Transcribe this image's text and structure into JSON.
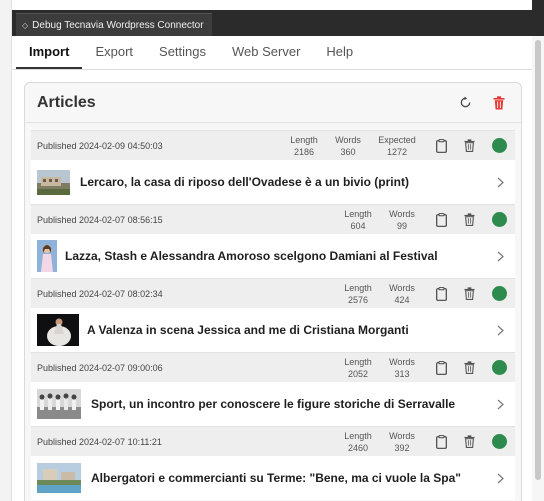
{
  "window": {
    "title": "Debug Tecnavia Wordpress Connector",
    "title_icon": "diamond-icon"
  },
  "tabs": [
    {
      "label": "Import",
      "active": true
    },
    {
      "label": "Export",
      "active": false
    },
    {
      "label": "Settings",
      "active": false
    },
    {
      "label": "Web Server",
      "active": false
    },
    {
      "label": "Help",
      "active": false
    }
  ],
  "panel": {
    "title": "Articles",
    "refresh_icon": "refresh-icon",
    "delete_all_icon": "trash-icon",
    "delete_color": "#e53935"
  },
  "labels": {
    "length": "Length",
    "words": "Words",
    "expected": "Expected"
  },
  "articles": [
    {
      "published": "Published 2024-02-09 04:50:03",
      "length": "2186",
      "words": "360",
      "expected": "1272",
      "headline": "Lercaro, la casa di riposo dell'Ovadese è a un bivio (print)",
      "status_color": "#2e8b4e",
      "thumb": "building-photo"
    },
    {
      "published": "Published 2024-02-07 08:56:15",
      "length": "604",
      "words": "99",
      "headline": "Lazza, Stash e Alessandra Amoroso scelgono Damiani al Festival",
      "status_color": "#2e8b4e",
      "thumb": "singer-photo"
    },
    {
      "published": "Published 2024-02-07 08:02:34",
      "length": "2576",
      "words": "424",
      "headline": "A Valenza in scena Jessica and me di Cristiana Morganti",
      "status_color": "#2e8b4e",
      "thumb": "stage-photo"
    },
    {
      "published": "Published 2024-02-07 09:00:06",
      "length": "2052",
      "words": "313",
      "headline": "Sport, un incontro per conoscere le figure storiche di Serravalle",
      "status_color": "#2e8b4e",
      "thumb": "team-photo"
    },
    {
      "published": "Published 2024-02-07 10:11:21",
      "length": "2460",
      "words": "392",
      "headline": "Albergatori e commercianti su Terme: \"Bene, ma ci vuole la Spa\"",
      "status_color": "#2e8b4e",
      "thumb": "spa-photo"
    }
  ]
}
